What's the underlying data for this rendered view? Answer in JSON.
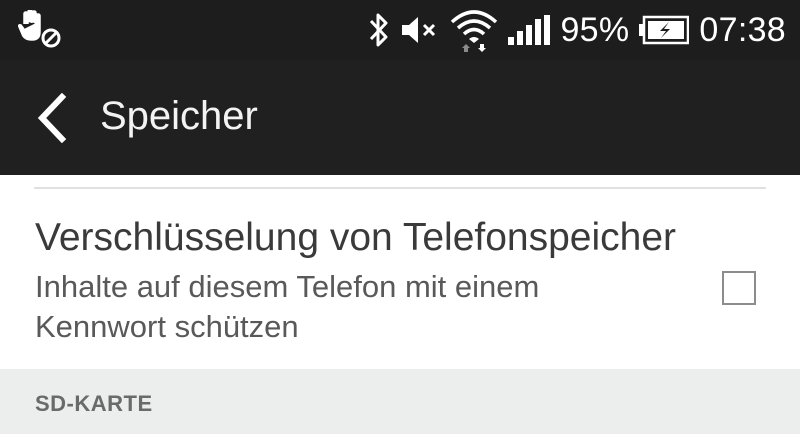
{
  "status_bar": {
    "battery_percent": "95%",
    "time": "07:38",
    "icons": [
      "hand-blocked-icon",
      "bluetooth-icon",
      "mute-icon",
      "wifi-icon",
      "signal-icon",
      "battery-charging-icon"
    ]
  },
  "action_bar": {
    "title": "Speicher",
    "back_icon": "chevron-left-icon"
  },
  "setting": {
    "title": "Verschlüsselung von Telefonspeicher",
    "summary": "Inhalte auf diesem Telefon mit einem Kennwort schützen",
    "checked": false
  },
  "section": {
    "label": "SD-KARTE"
  },
  "colors": {
    "status_bar_bg": "#1d1d1d",
    "action_bar_bg": "#202020",
    "section_bg": "#eceded",
    "title_text": "#3a3a3a",
    "summary_text": "#595959"
  }
}
